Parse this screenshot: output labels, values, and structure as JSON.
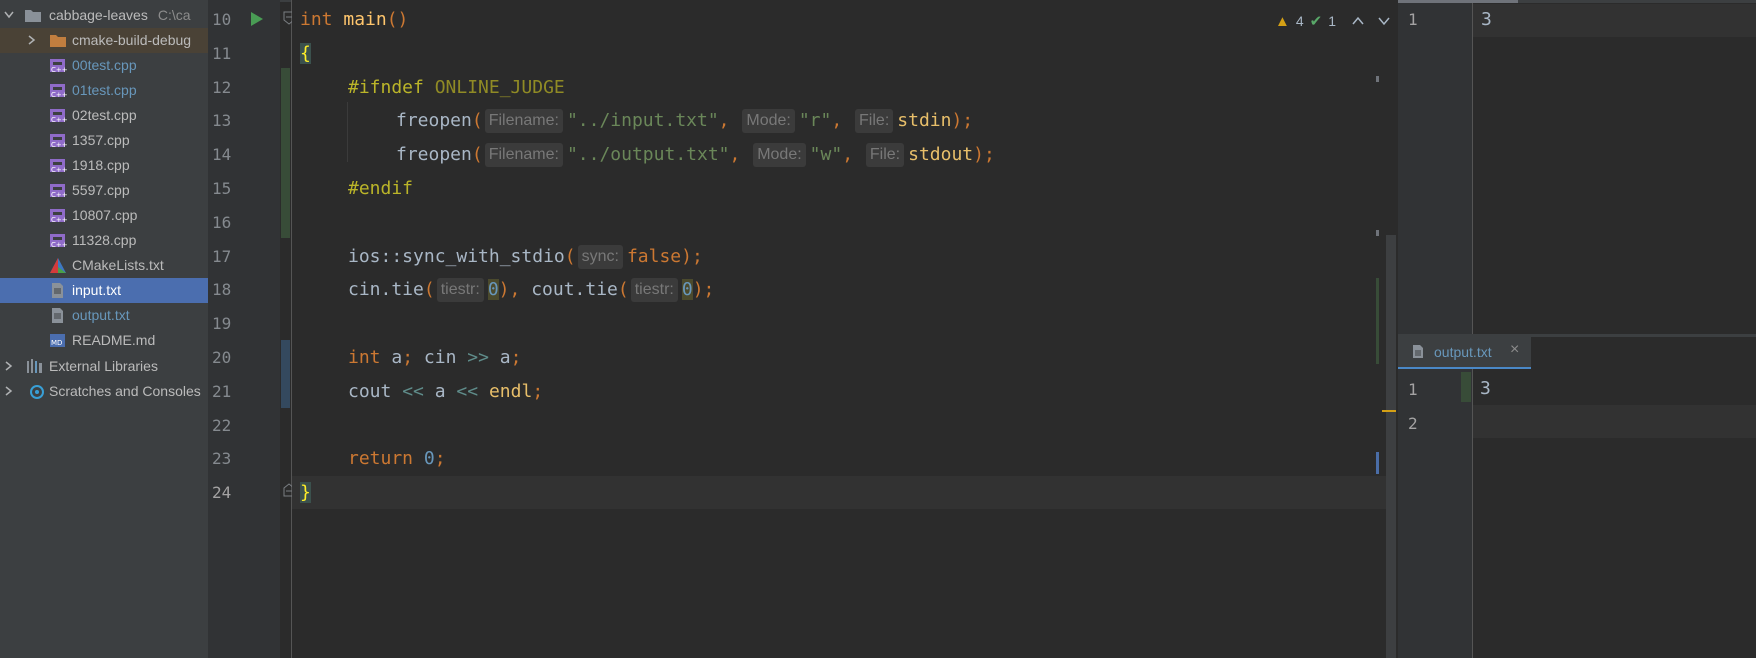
{
  "project_tree": {
    "root": {
      "name": "cabbage-leaves",
      "path": "C:\\ca"
    },
    "items": [
      {
        "label": "cmake-build-debug",
        "kind": "folder",
        "expanded": false,
        "color": "#bbbbbb"
      },
      {
        "label": "00test.cpp",
        "kind": "cpp",
        "color": "#6897bb"
      },
      {
        "label": "01test.cpp",
        "kind": "cpp",
        "color": "#6897bb"
      },
      {
        "label": "02test.cpp",
        "kind": "cpp",
        "color": "#bbbbbb"
      },
      {
        "label": "1357.cpp",
        "kind": "cpp",
        "color": "#bbbbbb"
      },
      {
        "label": "1918.cpp",
        "kind": "cpp",
        "color": "#bbbbbb"
      },
      {
        "label": "5597.cpp",
        "kind": "cpp",
        "color": "#bbbbbb"
      },
      {
        "label": "10807.cpp",
        "kind": "cpp",
        "color": "#bbbbbb"
      },
      {
        "label": "11328.cpp",
        "kind": "cpp",
        "color": "#bbbbbb"
      },
      {
        "label": "CMakeLists.txt",
        "kind": "cmake",
        "color": "#bbbbbb"
      },
      {
        "label": "input.txt",
        "kind": "txt",
        "color": "#ffffff",
        "selected": true
      },
      {
        "label": "output.txt",
        "kind": "txt",
        "color": "#6897bb"
      },
      {
        "label": "README.md",
        "kind": "md",
        "color": "#bbbbbb"
      }
    ],
    "external_libraries": "External Libraries",
    "scratches": "Scratches and Consoles"
  },
  "editor": {
    "line_numbers": [
      "10",
      "11",
      "12",
      "13",
      "14",
      "15",
      "16",
      "17",
      "18",
      "19",
      "20",
      "21",
      "22",
      "23",
      "24"
    ],
    "current_line": "24",
    "inspections": {
      "warnings": "4",
      "weak_warnings": "1"
    },
    "code": {
      "l10": {
        "kw": "int",
        "fn": "main",
        "parens": "()"
      },
      "l11": {
        "brace": "{"
      },
      "l12": {
        "directive": "#ifndef",
        "macro": "ONLINE_JUDGE"
      },
      "l13": {
        "fn": "freopen",
        "hint1": "Filename:",
        "arg1": "\"../input.txt\"",
        "hint2": "Mode:",
        "arg2": "\"r\"",
        "hint3": "File:",
        "arg3": "stdin"
      },
      "l14": {
        "fn": "freopen",
        "hint1": "Filename:",
        "arg1": "\"../output.txt\"",
        "hint2": "Mode:",
        "arg2": "\"w\"",
        "hint3": "File:",
        "arg3": "stdout"
      },
      "l15": {
        "directive": "#endif"
      },
      "l17": {
        "call": "ios::sync_with_stdio",
        "hint": "sync:",
        "arg": "false"
      },
      "l18": {
        "call1": "cin.tie",
        "hint1": "tiestr:",
        "arg1": "0",
        "call2": "cout.tie",
        "hint2": "tiestr:",
        "arg2": "0"
      },
      "l20": {
        "kw": "int",
        "var": "a",
        "stream": "cin",
        "op": ">>",
        "var2": "a"
      },
      "l21": {
        "stream": "cout",
        "op1": "<<",
        "var": "a",
        "op2": "<<",
        "endl": "endl"
      },
      "l23": {
        "kw": "return",
        "num": "0"
      },
      "l24": {
        "brace": "}"
      }
    }
  },
  "input_pane": {
    "line_numbers": [
      "1"
    ],
    "lines": [
      "3"
    ]
  },
  "output_pane": {
    "tab_label": "output.txt",
    "close_glyph": "×",
    "line_numbers": [
      "1",
      "2"
    ],
    "lines": [
      "3",
      ""
    ]
  },
  "icons": [
    "folder-icon",
    "cpp-file-icon",
    "cmake-icon",
    "text-file-icon",
    "markdown-icon",
    "library-icon",
    "scratches-icon",
    "run-icon",
    "fold-icon",
    "warning-icon",
    "weak-warning-icon",
    "chevron-up-icon",
    "chevron-down-icon"
  ],
  "colors": {
    "accent": "#4b6eaf",
    "keyword": "#cc7832",
    "function": "#ffc66d",
    "string": "#6a8759",
    "number": "#6897bb"
  }
}
